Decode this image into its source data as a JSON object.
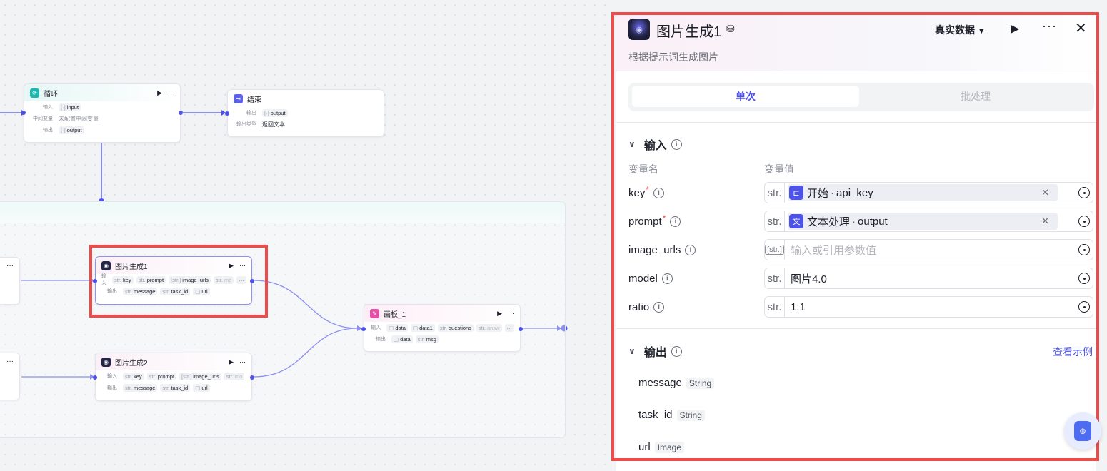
{
  "colors": {
    "accent": "#4d53e8",
    "highlight": "#f04b4b",
    "required": "#f04b4b"
  },
  "canvas": {
    "loop_node": {
      "title": "循环",
      "inputs_label": "输入",
      "input_var": "input",
      "mid_label": "中间变量",
      "mid_value": "未配置中间变量",
      "outputs_label": "输出",
      "output_var": "output"
    },
    "end_node": {
      "title": "结束",
      "outputs_label": "输出",
      "output_var": "output",
      "type_label": "输出类型",
      "type_value": "返回文本"
    },
    "image_node_1": {
      "title": "图片生成1",
      "inputs_label": "输入",
      "in_key": "key",
      "in_prompt": "prompt",
      "in_urls": "image_urls",
      "in_more": "mo",
      "outputs_label": "输出",
      "out_message": "message",
      "out_task": "task_id",
      "out_url": "url"
    },
    "image_node_2": {
      "title": "图片生成2",
      "inputs_label": "输入",
      "in_key": "key",
      "in_prompt": "prompt",
      "in_urls": "image_urls",
      "in_more": "mo",
      "outputs_label": "输出",
      "out_message": "message",
      "out_task": "task_id",
      "out_url": "url"
    },
    "canvas_node": {
      "title": "画板_1",
      "inputs_label": "输入",
      "in_data": "data",
      "in_data1": "data1",
      "in_questions": "questions",
      "in_more": "answ",
      "outputs_label": "输出",
      "out_data": "data",
      "out_msg": "msg"
    }
  },
  "panel": {
    "title": "图片生成1",
    "description": "根据提示词生成图片",
    "real_data_label": "真实数据",
    "tabs": [
      "单次",
      "批处理"
    ],
    "input_section": "输入",
    "col_name": "变量名",
    "col_value": "变量值",
    "params": [
      {
        "name": "key",
        "required": true,
        "type": "str.",
        "ref_node": "开始",
        "ref_var": "api_key"
      },
      {
        "name": "prompt",
        "required": true,
        "type": "str.",
        "ref_node": "文本处理",
        "ref_var": "output"
      },
      {
        "name": "image_urls",
        "required": false,
        "type": "[str.]",
        "placeholder": "输入或引用参数值"
      },
      {
        "name": "model",
        "required": false,
        "type": "str.",
        "value": "图片4.0"
      },
      {
        "name": "ratio",
        "required": false,
        "type": "str.",
        "value": "1:1"
      }
    ],
    "output_section": "输出",
    "view_example": "查看示例",
    "outputs": [
      {
        "name": "message",
        "type": "String"
      },
      {
        "name": "task_id",
        "type": "String"
      },
      {
        "name": "url",
        "type": "Image"
      }
    ]
  }
}
